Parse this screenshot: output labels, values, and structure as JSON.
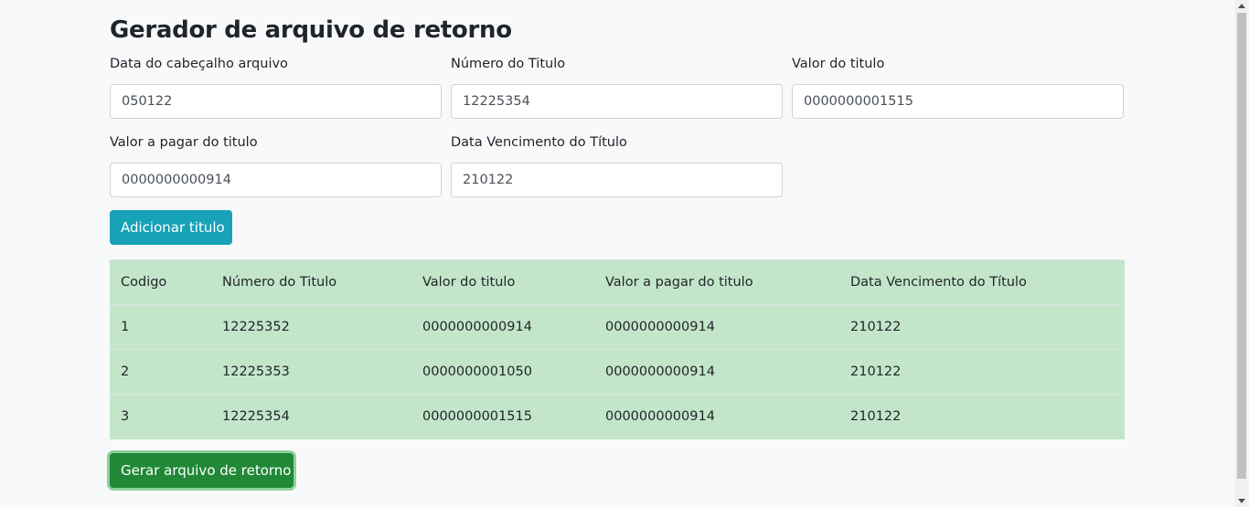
{
  "title": "Gerador de arquivo de retorno",
  "fields": [
    {
      "label": "Data do cabeçalho arquivo",
      "value": "050122"
    },
    {
      "label": "Número do Titulo",
      "value": "12225354"
    },
    {
      "label": "Valor do titulo",
      "value": "0000000001515"
    },
    {
      "label": "Valor a pagar do titulo",
      "value": "0000000000914"
    },
    {
      "label": "Data Vencimento do Título",
      "value": "210122"
    }
  ],
  "add_button": "Adicionar titulo",
  "table": {
    "headers": [
      "Codigo",
      "Número do Titulo",
      "Valor do titulo",
      "Valor a pagar do titulo",
      "Data Vencimento do Título"
    ],
    "rows": [
      [
        "1",
        "12225352",
        "0000000000914",
        "0000000000914",
        "210122"
      ],
      [
        "2",
        "12225353",
        "0000000001050",
        "0000000000914",
        "210122"
      ],
      [
        "3",
        "12225354",
        "0000000001515",
        "0000000000914",
        "210122"
      ]
    ]
  },
  "generate_button": "Gerar arquivo de retorno",
  "colors": {
    "info": "#17a2b8",
    "success": "#218838",
    "table_success": "#c3e6cb"
  }
}
